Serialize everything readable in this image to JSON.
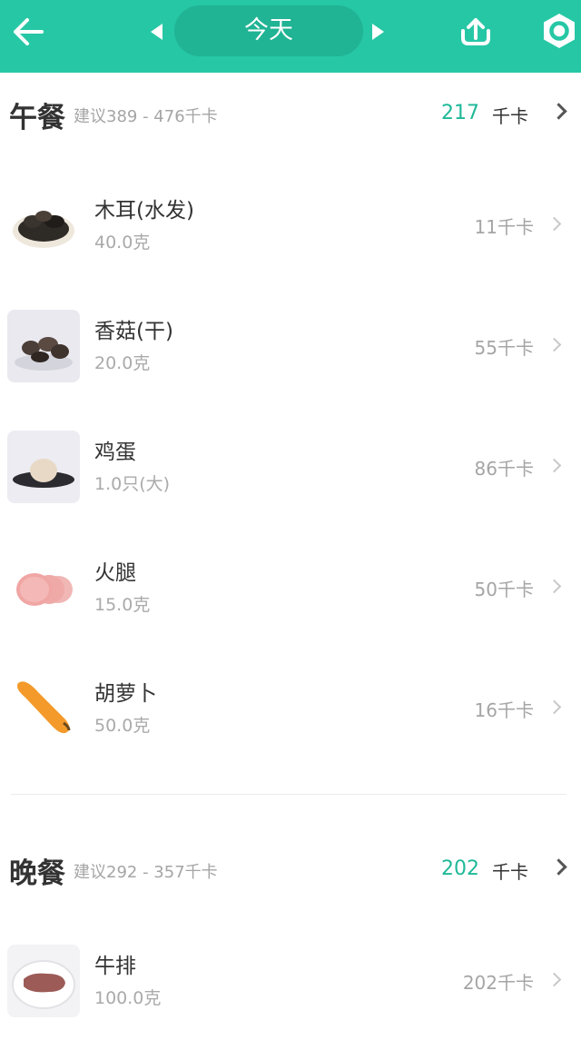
{
  "header": {
    "date_label": "今天",
    "accent_color": "#26C7A5",
    "icons": [
      "back-arrow-icon",
      "prev-day-icon",
      "next-day-icon",
      "share-upload-icon",
      "settings-icon"
    ]
  },
  "meals": [
    {
      "title": "午餐",
      "suggestion": "建议389 - 476千卡",
      "kcal": "217",
      "unit": "千卡",
      "items": [
        {
          "name": "木耳(水发)",
          "amount": "40.0克",
          "kcal": "11千卡"
        },
        {
          "name": "香菇(干)",
          "amount": "20.0克",
          "kcal": "55千卡"
        },
        {
          "name": "鸡蛋",
          "amount": "1.0只(大)",
          "kcal": "86千卡"
        },
        {
          "name": "火腿",
          "amount": "15.0克",
          "kcal": "50千卡"
        },
        {
          "name": "胡萝卜",
          "amount": "50.0克",
          "kcal": "16千卡"
        }
      ]
    },
    {
      "title": "晚餐",
      "suggestion": "建议292 - 357千卡",
      "kcal": "202",
      "unit": "千卡",
      "items": [
        {
          "name": "牛排",
          "amount": "100.0克",
          "kcal": "202千卡"
        }
      ]
    }
  ]
}
